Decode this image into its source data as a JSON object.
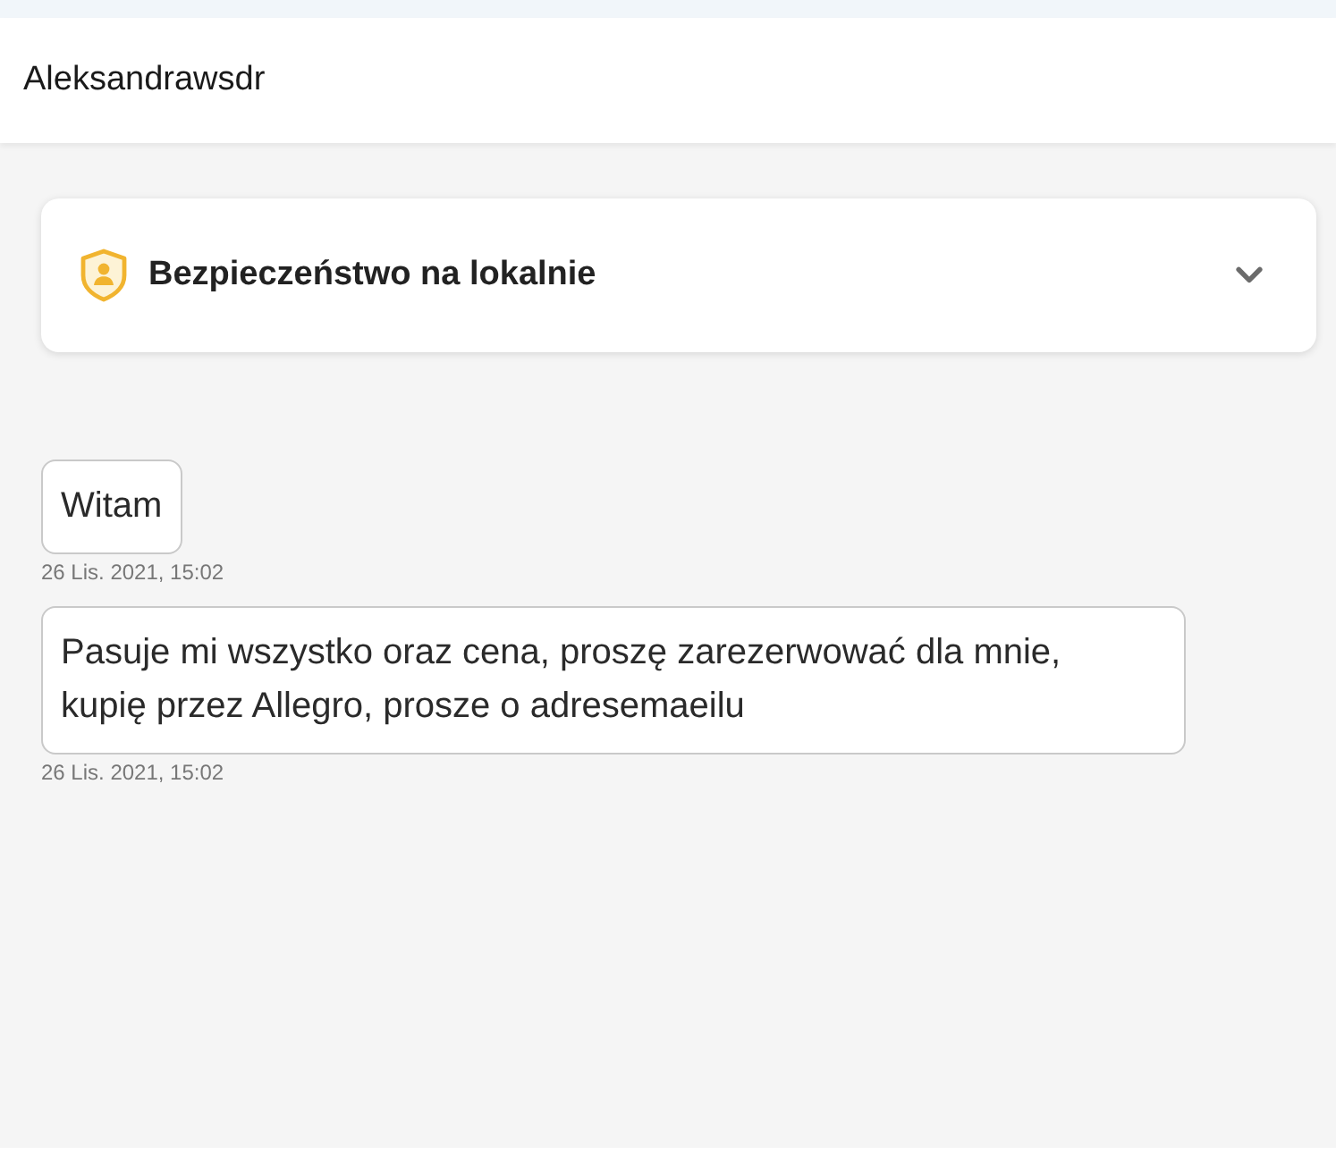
{
  "header": {
    "title": "Aleksandrawsdr"
  },
  "safety_panel": {
    "title": "Bezpieczeństwo na lokalnie",
    "expanded": false
  },
  "messages": [
    {
      "text": "Witam",
      "time": "26 Lis. 2021, 15:02"
    },
    {
      "text": "Pasuje mi wszystko oraz cena, proszę zarezerwować dla mnie, kupię przez Allegro, prosze o adresemaeilu",
      "time": "26 Lis. 2021, 15:02"
    }
  ]
}
